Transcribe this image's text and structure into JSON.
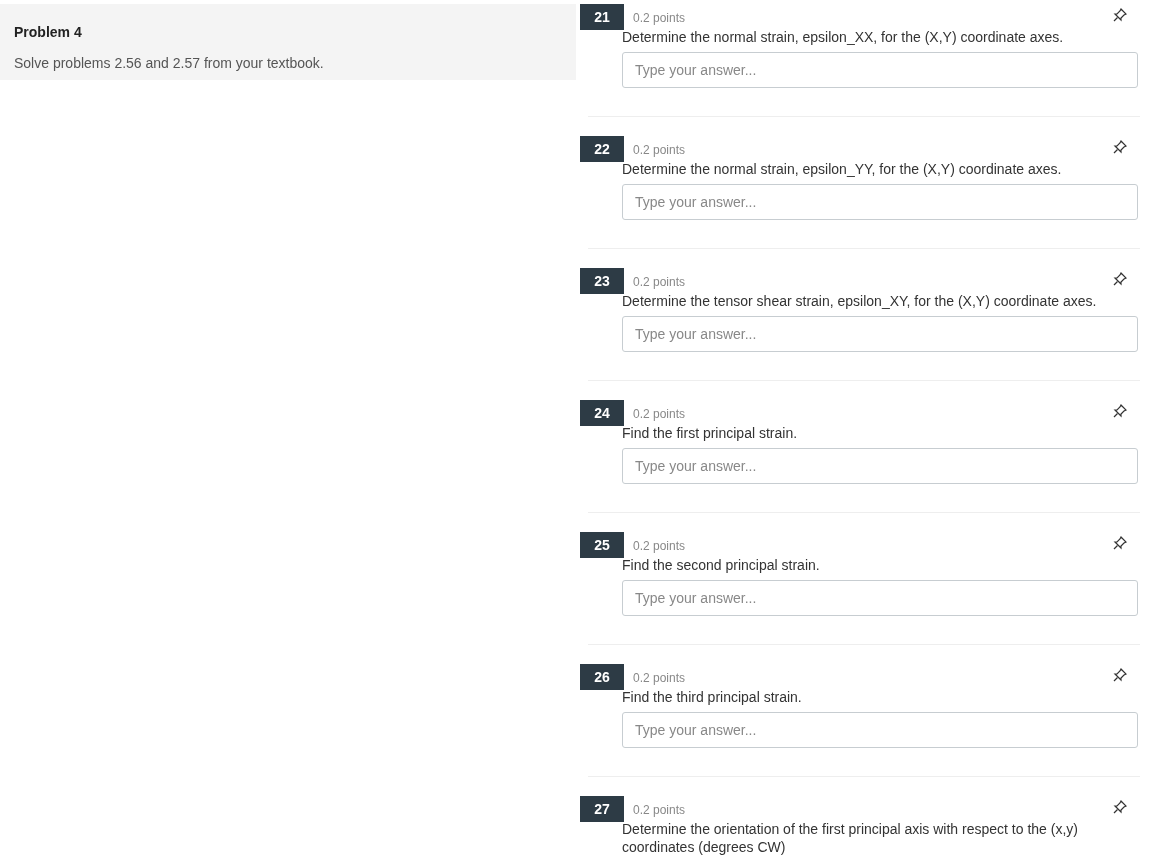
{
  "intro": {
    "title": "Problem 4",
    "text": "Solve problems 2.56 and 2.57 from your textbook."
  },
  "questions": [
    {
      "number": "21",
      "points": "0.2 points",
      "text": "Determine the normal strain, epsilon_XX, for the (X,Y) coordinate axes.",
      "placeholder": "Type your answer..."
    },
    {
      "number": "22",
      "points": "0.2 points",
      "text": "Determine the normal strain, epsilon_YY, for the (X,Y) coordinate axes.",
      "placeholder": "Type your answer..."
    },
    {
      "number": "23",
      "points": "0.2 points",
      "text": "Determine the tensor shear strain, epsilon_XY, for the (X,Y) coordinate axes.",
      "placeholder": "Type your answer..."
    },
    {
      "number": "24",
      "points": "0.2 points",
      "text": "Find the first principal strain.",
      "placeholder": "Type your answer..."
    },
    {
      "number": "25",
      "points": "0.2 points",
      "text": "Find the second principal strain.",
      "placeholder": "Type your answer..."
    },
    {
      "number": "26",
      "points": "0.2 points",
      "text": "Find the third principal strain.",
      "placeholder": "Type your answer..."
    },
    {
      "number": "27",
      "points": "0.2 points",
      "text": "Determine the orientation of the first principal axis with respect to the (x,y) coordinates (degrees CW)"
    }
  ]
}
